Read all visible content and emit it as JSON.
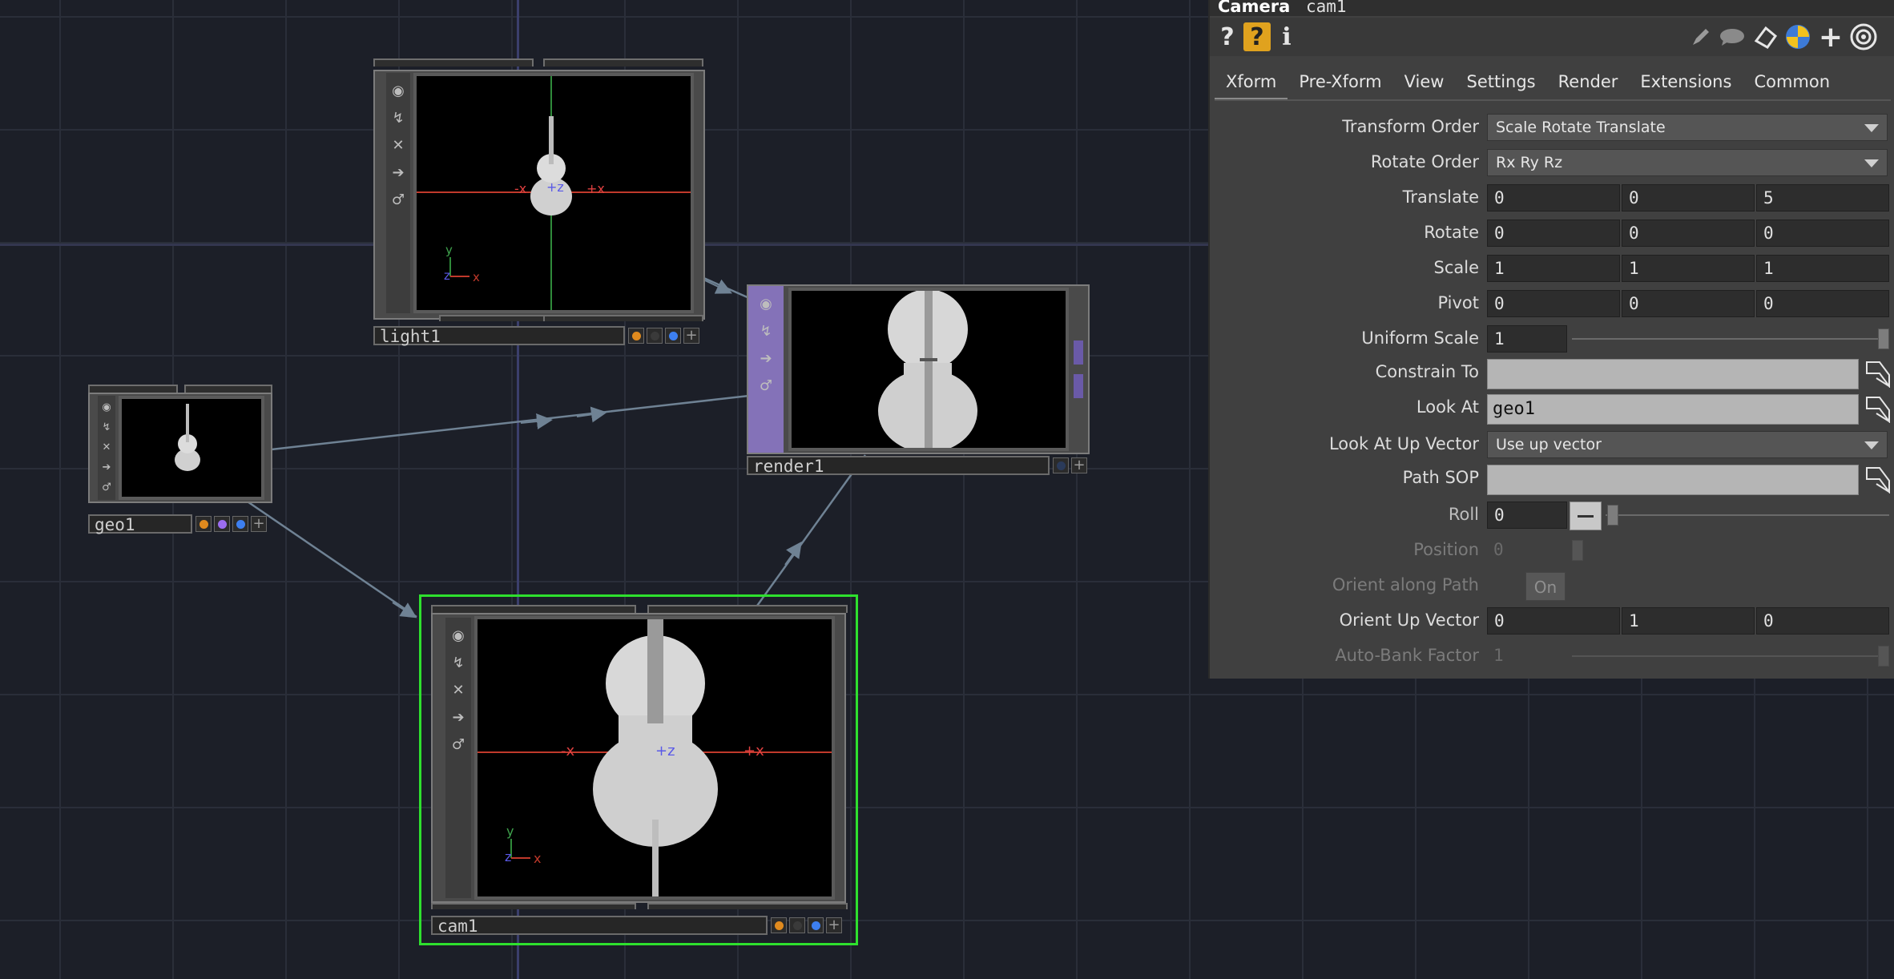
{
  "panel": {
    "op_type": "Camera",
    "op_name": "cam1",
    "toolbar": {
      "help": "?",
      "python_help": "?",
      "info": "i",
      "add": "+"
    },
    "tabs": [
      "Xform",
      "Pre-Xform",
      "View",
      "Settings",
      "Render",
      "Extensions",
      "Common"
    ],
    "active_tab": "Xform",
    "params": {
      "transform_order": {
        "label": "Transform Order",
        "value": "Scale Rotate Translate"
      },
      "rotate_order": {
        "label": "Rotate Order",
        "value": "Rx Ry Rz"
      },
      "translate": {
        "label": "Translate",
        "values": [
          "0",
          "0",
          "5"
        ]
      },
      "rotate": {
        "label": "Rotate",
        "values": [
          "0",
          "0",
          "0"
        ]
      },
      "scale": {
        "label": "Scale",
        "values": [
          "1",
          "1",
          "1"
        ]
      },
      "pivot": {
        "label": "Pivot",
        "values": [
          "0",
          "0",
          "0"
        ]
      },
      "uniform_scale": {
        "label": "Uniform Scale",
        "value": "1"
      },
      "constrain_to": {
        "label": "Constrain To",
        "value": ""
      },
      "look_at": {
        "label": "Look At",
        "value": "geo1"
      },
      "look_at_up_vector": {
        "label": "Look At Up Vector",
        "value": "Use up vector"
      },
      "path_sop": {
        "label": "Path SOP",
        "value": ""
      },
      "roll": {
        "label": "Roll",
        "value": "0"
      },
      "position": {
        "label": "Position",
        "value": "0"
      },
      "orient_along_path": {
        "label": "Orient along Path",
        "value": "On"
      },
      "orient_up_vector": {
        "label": "Orient Up Vector",
        "values": [
          "0",
          "1",
          "0"
        ]
      },
      "auto_bank_factor": {
        "label": "Auto-Bank Factor",
        "value": "1"
      }
    }
  },
  "nodes": {
    "light1": {
      "name": "light1",
      "axis_labels": [
        "-x",
        "+z",
        "+x",
        "y",
        "z",
        "x"
      ]
    },
    "render1": {
      "name": "render1"
    },
    "geo1": {
      "name": "geo1"
    },
    "cam1": {
      "name": "cam1",
      "axis_labels": [
        "-x",
        "+z",
        "+x",
        "y",
        "z",
        "x"
      ]
    }
  },
  "colors": {
    "selected_outline": "#2ee02e",
    "render_side": "#8472b8",
    "flag_orange": "#e08a1e",
    "flag_purple": "#9b6df0",
    "flag_blue": "#3d7ff0",
    "wire": "#6f8294",
    "axis_red": "#c0392b",
    "axis_green": "#2f8a3a",
    "axis_blue": "#5a5ae8"
  }
}
